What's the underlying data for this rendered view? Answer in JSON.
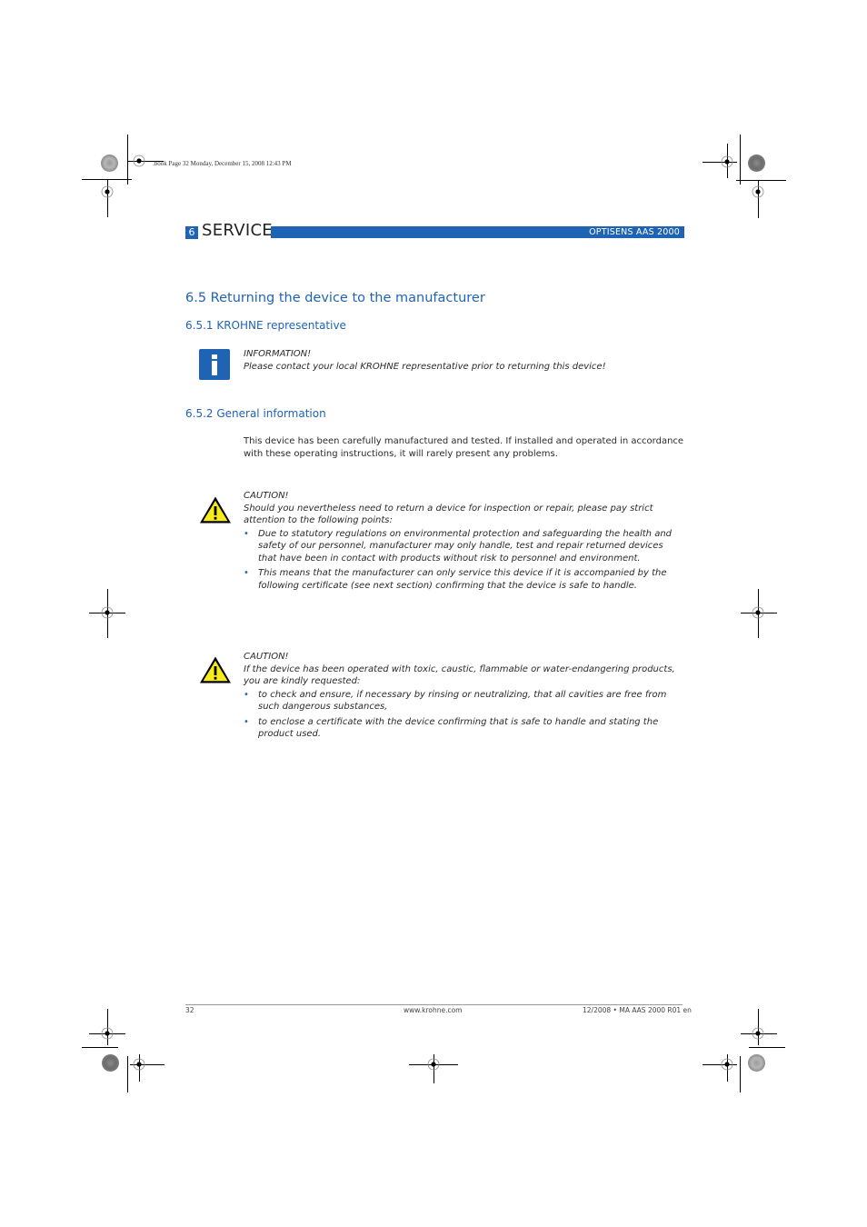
{
  "print_slug": ".book  Page 32  Monday, December 15, 2008  12:43 PM",
  "header": {
    "chapter_number": "6",
    "chapter_title": "SERVICE",
    "product": "OPTISENS AAS 2000",
    "accent_color": "#1f63b5"
  },
  "section": {
    "title": "6.5  Returning the device to the manufacturer"
  },
  "subsections": [
    {
      "title": "6.5.1  KROHNE representative",
      "info": {
        "icon": "information-icon",
        "heading": "INFORMATION!",
        "text": "Please contact your local KROHNE representative prior to returning this device!"
      }
    },
    {
      "title": "6.5.2  General information",
      "paragraph": "This device has been carefully manufactured and tested. If installed and operated in accordance with these operating instructions, it will rarely present any problems.",
      "cautions": [
        {
          "icon": "warning-triangle-icon",
          "heading": "CAUTION!",
          "text": "Should you nevertheless need to return a device for inspection or repair, please pay strict attention to the following points:",
          "bullets": [
            "Due to statutory regulations on environmental protection and safeguarding the health and safety of our personnel, manufacturer may only handle, test and repair returned devices that have been in contact with products without risk to personnel and environment.",
            "This means that the manufacturer can only service this device if it is accompanied by the following certificate (see next section) confirming that the device is safe to handle."
          ]
        },
        {
          "icon": "warning-triangle-icon",
          "heading": "CAUTION!",
          "text": "If the device has been operated with toxic, caustic, flammable or water-endangering products, you are kindly requested:",
          "bullets": [
            "to check and ensure, if necessary by rinsing or neutralizing, that all cavities are free from such dangerous substances,",
            "to enclose a certificate with the device confirming that is safe to handle and stating the product used."
          ]
        }
      ]
    }
  ],
  "bullet_glyph": "•",
  "footer": {
    "page_number": "32",
    "website": "www.krohne.com",
    "doc_ref": "12/2008 • MA AAS 2000 R01 en"
  }
}
